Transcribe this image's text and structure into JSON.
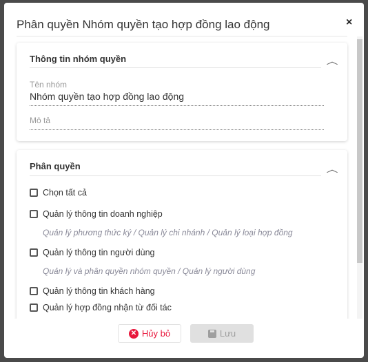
{
  "dialog": {
    "title": "Phân quyền Nhóm quyền tạo hợp đồng lao động",
    "close": "×"
  },
  "info": {
    "title": "Thông tin nhóm quyền",
    "name_label": "Tên nhóm",
    "name_value": "Nhóm quyền tạo hợp đồng lao động",
    "desc_label": "Mô tả",
    "desc_value": ""
  },
  "perm": {
    "title": "Phân quyền",
    "select_all": "Chọn tất cả",
    "items": [
      {
        "label": "Quản lý thông tin doanh nghiệp",
        "sub": "Quản lý phương thức ký / Quản lý chi nhánh / Quản lý loại hợp đồng"
      },
      {
        "label": "Quản lý thông tin người dùng",
        "sub": "Quản lý và phân quyền nhóm quyền / Quản lý người dùng"
      },
      {
        "label": "Quản lý thông tin khách hàng"
      },
      {
        "label": "Quản lý hợp đồng nhận từ đối tác"
      }
    ]
  },
  "footer": {
    "cancel": "Hủy bỏ",
    "save": "Lưu"
  }
}
